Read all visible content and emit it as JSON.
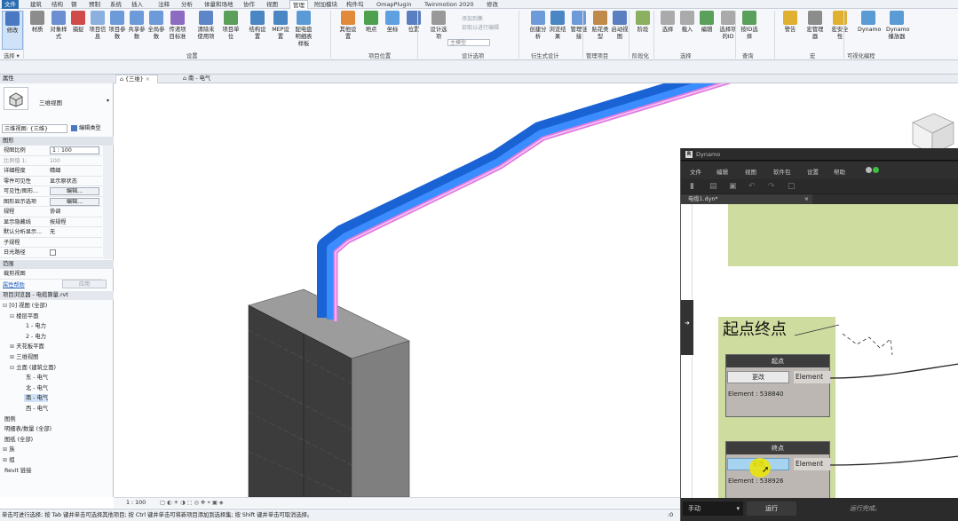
{
  "menubar": {
    "tabs": [
      "文件",
      "建筑",
      "结构",
      "钢",
      "预制",
      "系统",
      "插入",
      "注释",
      "分析",
      "体量和场地",
      "协作",
      "视图",
      "管理",
      "附加模块",
      "构件坞",
      "OmapPlugin",
      "Twinmotion 2020",
      "修改"
    ],
    "active_tab": "文件",
    "selected_tab": "管理"
  },
  "ribbon": {
    "buttons": [
      "修改",
      "材质",
      "对象样式",
      "捕捉",
      "项目信息",
      "项目参数",
      "共享参数",
      "全局参数",
      "传递项目标准",
      "清除未使用项",
      "项目单位",
      "结构设置",
      "MEP设置",
      "配电盘明细表样板",
      "其他设置",
      "地点",
      "坐标",
      "位置",
      "设计选项",
      "主模型",
      "创建分析",
      "浏览结果",
      "管理链接",
      "贴花类型",
      "启动视图",
      "阶段",
      "选择",
      "载入",
      "编辑",
      "选择项的ID",
      "按ID选择",
      "警告",
      "宏管理器",
      "宏安全性",
      "Dynamo",
      "Dynamo播放器"
    ],
    "small_buttons": [
      "添加到集",
      "拾取以进行编辑"
    ],
    "groups": [
      "选择 ▾",
      "设置",
      "项目位置",
      "设计选项",
      "衍生式设计",
      "管理项目",
      "阶段化",
      "选择",
      "查询",
      "宏",
      "可视化编程"
    ]
  },
  "properties": {
    "title": "属性",
    "type_name": "三维视图",
    "selector": "三维视图: {三维}",
    "edit_type": "编辑类型",
    "section_graphics": "图形",
    "rows": [
      {
        "k": "视图比例",
        "v": "1 : 100",
        "kind": "box"
      },
      {
        "k": "比例值 1:",
        "v": "100",
        "kind": "text",
        "dim": true
      },
      {
        "k": "详细程度",
        "v": "精细",
        "kind": "text"
      },
      {
        "k": "零件可见性",
        "v": "显示原状态",
        "kind": "text"
      },
      {
        "k": "可见性/图形...",
        "v": "编辑...",
        "kind": "btn"
      },
      {
        "k": "图形显示选项",
        "v": "编辑...",
        "kind": "btn"
      },
      {
        "k": "规程",
        "v": "协调",
        "kind": "text"
      },
      {
        "k": "显示隐藏线",
        "v": "按规程",
        "kind": "text"
      },
      {
        "k": "默认分析显示...",
        "v": "无",
        "kind": "text"
      },
      {
        "k": "子规程",
        "v": "",
        "kind": "text"
      },
      {
        "k": "日光路径",
        "v": "",
        "kind": "check"
      }
    ],
    "section_extents": "范围",
    "crop_view": "裁剪视图",
    "help_link": "属性帮助",
    "apply": "应用"
  },
  "browser": {
    "title": "项目浏览器 - 电缆算量.rvt",
    "nodes": [
      {
        "label": "[0] 视图 (全部)",
        "indent": 0,
        "exp": "⊟"
      },
      {
        "label": "楼层平面",
        "indent": 1,
        "exp": "⊟"
      },
      {
        "label": "1 - 电力",
        "indent": 3,
        "exp": ""
      },
      {
        "label": "2 - 电力",
        "indent": 3,
        "exp": ""
      },
      {
        "label": "天花板平面",
        "indent": 1,
        "exp": "⊞"
      },
      {
        "label": "三维视图",
        "indent": 1,
        "exp": "⊞"
      },
      {
        "label": "立面 (建筑立面)",
        "indent": 1,
        "exp": "⊟"
      },
      {
        "label": "东 - 电气",
        "indent": 3,
        "exp": ""
      },
      {
        "label": "北 - 电气",
        "indent": 3,
        "exp": ""
      },
      {
        "label": "南 - 电气",
        "indent": 3,
        "exp": "",
        "sel": true
      },
      {
        "label": "西 - 电气",
        "indent": 3,
        "exp": ""
      },
      {
        "label": "图例",
        "indent": 0,
        "exp": ""
      },
      {
        "label": "明细表/数量 (全部)",
        "indent": 0,
        "exp": ""
      },
      {
        "label": "图纸 (全部)",
        "indent": 0,
        "exp": ""
      },
      {
        "label": "族",
        "indent": 0,
        "exp": "⊞"
      },
      {
        "label": "组",
        "indent": 0,
        "exp": "⊞"
      },
      {
        "label": "Revit 链接",
        "indent": 0,
        "exp": ""
      }
    ]
  },
  "viewtabs": [
    "{三维}",
    "南 - 电气"
  ],
  "view_control": {
    "scale": "1 : 100"
  },
  "status_bar": {
    "text": "单击可进行选择; 按 Tab 键并单击可选择其他项目; 按 Ctrl 键并单击可将新项目添加到选择集; 按 Shift 键并单击可取消选择。",
    "selection_count": ":0"
  },
  "dynamo": {
    "title": "Dynamo",
    "menu": [
      "文件",
      "编辑",
      "视图",
      "软件包",
      "设置",
      "帮助"
    ],
    "file_tab": "电缆1.dyn*",
    "group_title": "起点终点",
    "nodes": [
      {
        "title": "起点",
        "button": "更改",
        "port": "Element",
        "value": "Element : 538840"
      },
      {
        "title": "终点",
        "button": "更改",
        "port": "Element",
        "value": "Element : 538926"
      }
    ],
    "run_mode": "手动",
    "run_button": "运行",
    "run_status": "运行完成。"
  },
  "colors": {
    "accent": "#2b6cb0",
    "cable_tray": "#1f6fe8",
    "cable": "#e07be0",
    "group_bg": "#cfdc9f",
    "node_header": "#3d3d3d"
  }
}
